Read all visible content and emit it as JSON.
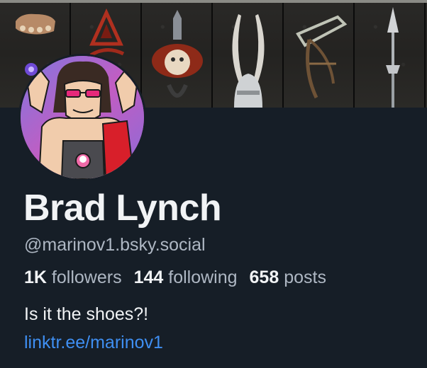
{
  "profile": {
    "display_name": "Brad Lynch",
    "handle": "@marinov1.bsky.social",
    "stats": {
      "followers_count": "1K",
      "followers_label": "followers",
      "following_count": "144",
      "following_label": "following",
      "posts_count": "658",
      "posts_label": "posts"
    },
    "bio": "Is it the shoes?!",
    "link": "linktr.ee/marinov1"
  },
  "colors": {
    "background": "#161e27",
    "primary_text": "#f1f3f5",
    "secondary_text": "#aeb7c3",
    "link": "#3f8ff2"
  },
  "banner": {
    "icons": [
      "gauntlet-icon",
      "triangle-rune-icon",
      "amulet-icon",
      "winged-helm-icon",
      "crossbow-icon",
      "spear-icon"
    ]
  }
}
